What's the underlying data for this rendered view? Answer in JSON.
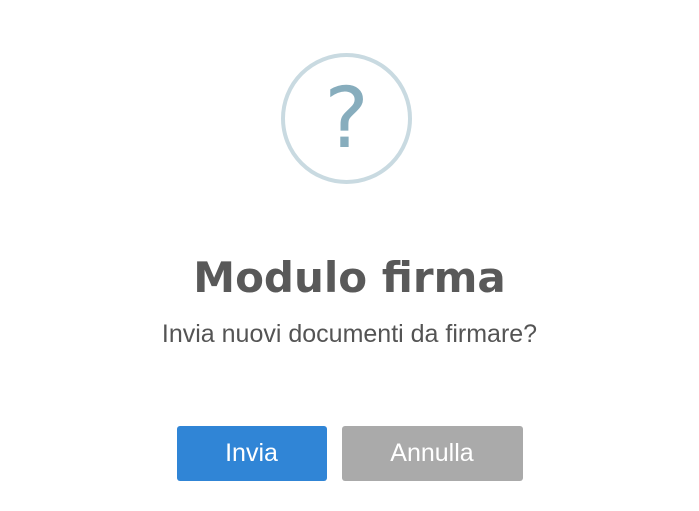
{
  "dialog": {
    "icon": "question-icon",
    "icon_glyph": "?",
    "title": "Modulo firma",
    "message": "Invia nuovi documenti da firmare?",
    "confirm_label": "Invia",
    "cancel_label": "Annulla"
  },
  "colors": {
    "icon_ring": "#c9dae1",
    "icon_glyph": "#87adbd",
    "confirm_button": "#3085d6",
    "cancel_button": "#aaaaaa",
    "title_text": "#595959",
    "message_text": "#545454"
  }
}
